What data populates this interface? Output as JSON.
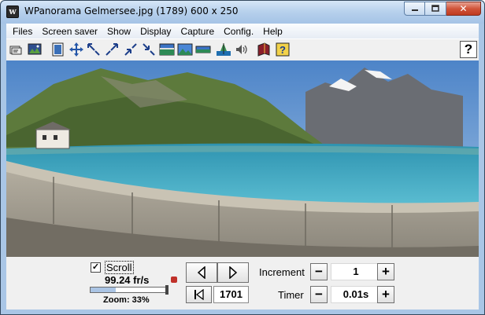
{
  "window": {
    "title": "WPanorama  Gelmersee.jpg  (1789) 600 x 250",
    "app_icon_glyph": "w",
    "controls": {
      "minimize": "minimize-icon",
      "maximize": "maximize-icon",
      "close": "close-icon",
      "close_glyph": "✕"
    }
  },
  "menu": [
    "Files",
    "Screen saver",
    "Show",
    "Display",
    "Capture",
    "Config.",
    "Help"
  ],
  "toolbar": {
    "buttons": [
      "open-file-icon",
      "picture-icon",
      "fit-page-icon",
      "move-icon",
      "zoom-out-icon",
      "zoom-in-icon",
      "shrink-icon",
      "expand-icon",
      "panorama-icon",
      "landscape-icon",
      "strip-icon",
      "horizon-icon",
      "sound-icon",
      "book-icon",
      "help-book-icon"
    ],
    "help_glyph": "?"
  },
  "panorama": {
    "description_icon": "panorama-image",
    "sky_color": "#5f8ec6",
    "water_color": "#3aa6c2"
  },
  "controls": {
    "scroll": {
      "checked": true,
      "check_glyph": "✓",
      "label": "Scroll"
    },
    "speed": "99.24 fr/s",
    "zoom": {
      "label": "Zoom: 33%",
      "value_pct": 33
    },
    "nav": {
      "prev": "play-left-icon",
      "next": "play-right-icon",
      "first": "skip-start-icon",
      "counter": "1701"
    },
    "increment": {
      "label": "Increment",
      "value": "1",
      "minus": "−",
      "plus": "+"
    },
    "timer": {
      "label": "Timer",
      "value": "0.01s",
      "minus": "−",
      "plus": "+"
    }
  }
}
